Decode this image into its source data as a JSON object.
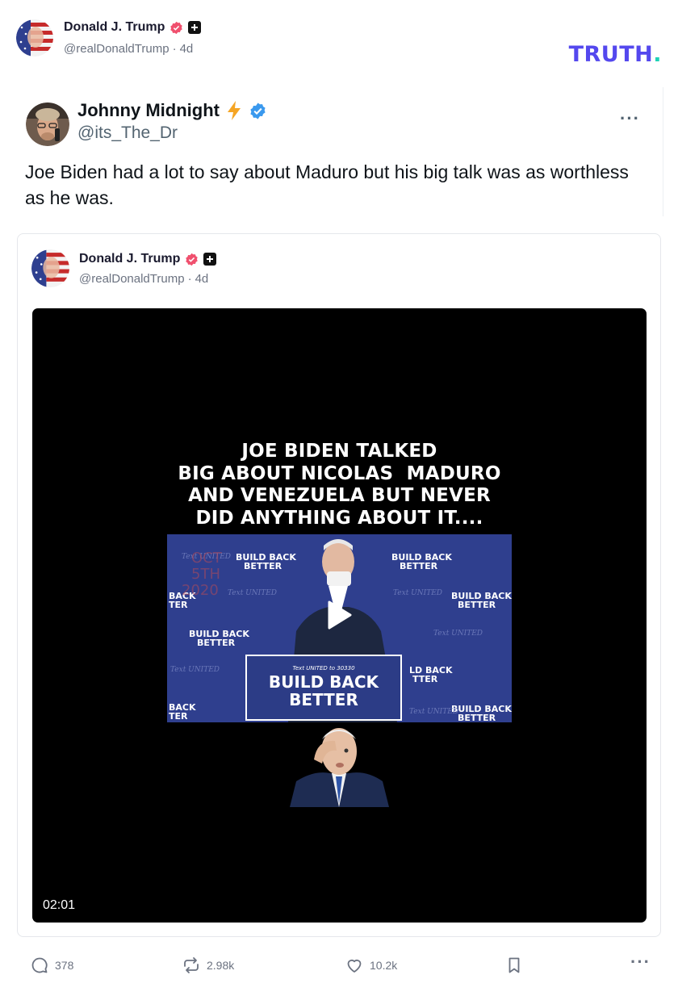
{
  "post": {
    "author_name": "Donald J. Trump",
    "handle": "@realDonaldTrump",
    "separator": "·",
    "time": "4d",
    "verified_icon": "verified-badge-icon",
    "plus_icon": "plus-badge-icon"
  },
  "brand": {
    "logo_text": "TRUTH",
    "logo_dot": ".",
    "accent": "#5448ee",
    "dot_color": "#1fd2b6"
  },
  "embedded_x_post": {
    "name": "Johnny Midnight",
    "handle": "@its_The_Dr",
    "more_label": "···",
    "text": "Joe Biden had a lot to say about Maduro but his big talk was as worthless as he was."
  },
  "quoted_post": {
    "author_name": "Donald J. Trump",
    "handle": "@realDonaldTrump",
    "separator": "·",
    "time": "4d",
    "video": {
      "caption_lines": [
        "JOE BIDEN TALKED",
        "BIG ABOUT NICOLAS  MADURO",
        "AND VENEZUELA BUT NEVER",
        "DID ANYTHING ABOUT IT...."
      ],
      "backdrop_text": "BUILD BACK BETTER",
      "podium_small": "Text UNITED to 30330",
      "podium_line1": "BUILD BACK",
      "podium_line2": "BETTER",
      "duration": "02:01"
    }
  },
  "actions": {
    "replies": "378",
    "retruths": "2.98k",
    "likes": "10.2k",
    "more_label": "···"
  }
}
